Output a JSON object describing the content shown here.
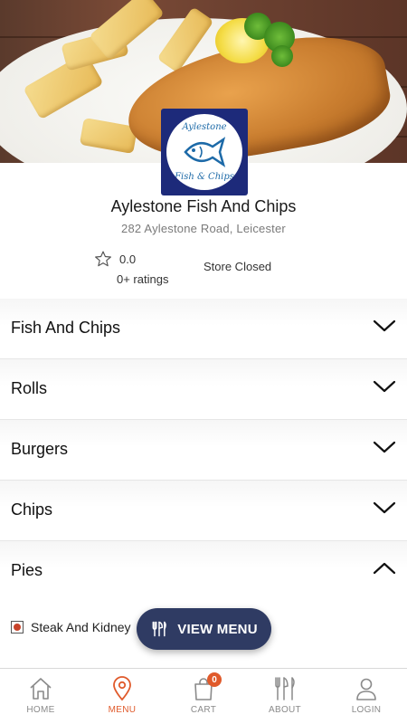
{
  "store": {
    "name": "Aylestone Fish And Chips",
    "address": "282 Aylestone Road, Leicester",
    "rating_value": "0.0",
    "rating_count": "0+ ratings",
    "status": "Store Closed",
    "logo": {
      "top_text": "Aylestone",
      "bottom_text": "Fish & Chips"
    }
  },
  "categories": [
    {
      "label": "Fish And Chips",
      "expanded": false
    },
    {
      "label": "Rolls",
      "expanded": false
    },
    {
      "label": "Burgers",
      "expanded": false
    },
    {
      "label": "Chips",
      "expanded": false
    },
    {
      "label": "Pies",
      "expanded": true
    }
  ],
  "pies_items": [
    {
      "label": "Steak And Kidney"
    }
  ],
  "view_menu_button": {
    "label": "VIEW MENU",
    "icon": "cutlery-icon"
  },
  "cart_count": "0",
  "bottom_nav": [
    {
      "label": "HOME",
      "icon": "home-icon",
      "active": false
    },
    {
      "label": "MENU",
      "icon": "location-pin-icon",
      "active": true
    },
    {
      "label": "CART",
      "icon": "shopping-bag-icon",
      "active": false
    },
    {
      "label": "ABOUT",
      "icon": "cutlery-icon",
      "active": false
    },
    {
      "label": "LOGIN",
      "icon": "user-icon",
      "active": false
    }
  ],
  "colors": {
    "accent": "#e05a2b",
    "view_menu_bg": "#2f3b63",
    "logo_bg": "#1d2a7a"
  }
}
